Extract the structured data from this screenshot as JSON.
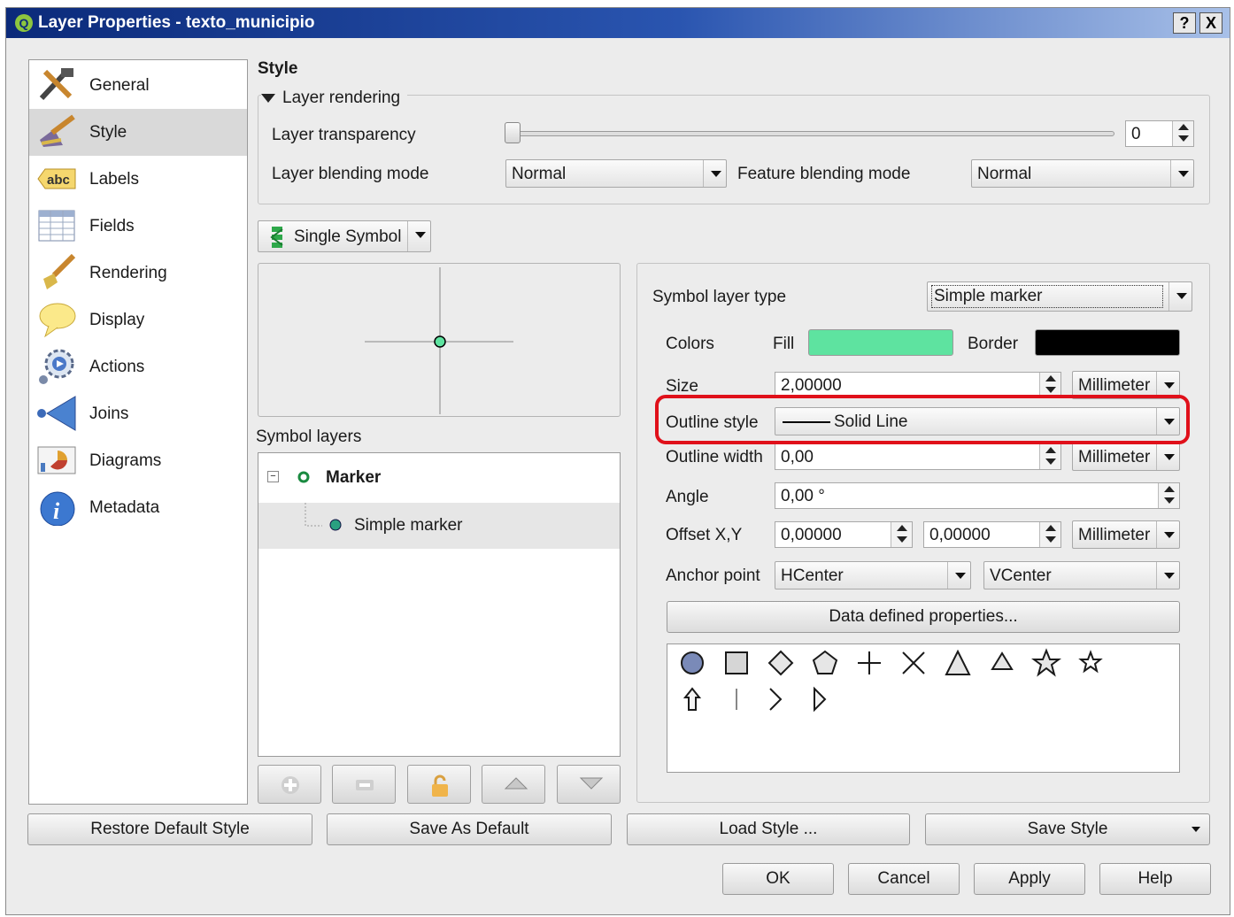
{
  "window": {
    "title": "Layer Properties - texto_municipio",
    "help_btn": "?",
    "close_btn": "X"
  },
  "nav": {
    "items": [
      {
        "label": "General",
        "icon": "general-tools-icon"
      },
      {
        "label": "Style",
        "icon": "style-brush-icon",
        "selected": true
      },
      {
        "label": "Labels",
        "icon": "labels-abc-icon"
      },
      {
        "label": "Fields",
        "icon": "fields-table-icon"
      },
      {
        "label": "Rendering",
        "icon": "rendering-brush-icon"
      },
      {
        "label": "Display",
        "icon": "display-bubble-icon"
      },
      {
        "label": "Actions",
        "icon": "actions-gear-icon"
      },
      {
        "label": "Joins",
        "icon": "joins-arrow-icon"
      },
      {
        "label": "Diagrams",
        "icon": "diagrams-chart-icon"
      },
      {
        "label": "Metadata",
        "icon": "metadata-info-icon"
      }
    ]
  },
  "style": {
    "heading": "Style",
    "layer_rendering": "Layer rendering",
    "transparency_label": "Layer transparency",
    "transparency_value": "0",
    "blending_label": "Layer blending mode",
    "blending_value": "Normal",
    "feature_blending_label": "Feature blending mode",
    "feature_blending_value": "Normal",
    "renderer": "Single Symbol",
    "symbol_layers_label": "Symbol layers",
    "tree": {
      "root": "Marker",
      "child": "Simple marker"
    }
  },
  "props": {
    "layer_type_label": "Symbol layer type",
    "layer_type_value": "Simple marker",
    "colors_label": "Colors",
    "fill_label": "Fill",
    "border_label": "Border",
    "fill_color": "#5ee3a0",
    "border_color": "#000000",
    "size_label": "Size",
    "size_value": "2,00000",
    "size_unit": "Millimeter",
    "outline_style_label": "Outline style",
    "outline_style_value": "Solid Line",
    "outline_width_label": "Outline width",
    "outline_width_value": "0,00",
    "outline_width_unit": "Millimeter",
    "angle_label": "Angle",
    "angle_value": "0,00 °",
    "offset_label": "Offset X,Y",
    "offset_x": "0,00000",
    "offset_y": "0,00000",
    "offset_unit": "Millimeter",
    "anchor_label": "Anchor point",
    "anchor_h": "HCenter",
    "anchor_v": "VCenter",
    "data_defined": "Data defined properties...",
    "highlight_color": "#e0101a",
    "shapes": [
      "circle",
      "square",
      "diamond",
      "pentagon",
      "cross",
      "x",
      "triangle",
      "equilateral-triangle",
      "star",
      "regular-star",
      "arrow",
      "line",
      "arrowhead",
      "filled-arrowhead"
    ]
  },
  "footer": {
    "restore": "Restore Default Style",
    "save_default": "Save As Default",
    "load": "Load Style ...",
    "save": "Save Style",
    "ok": "OK",
    "cancel": "Cancel",
    "apply": "Apply",
    "help": "Help"
  }
}
